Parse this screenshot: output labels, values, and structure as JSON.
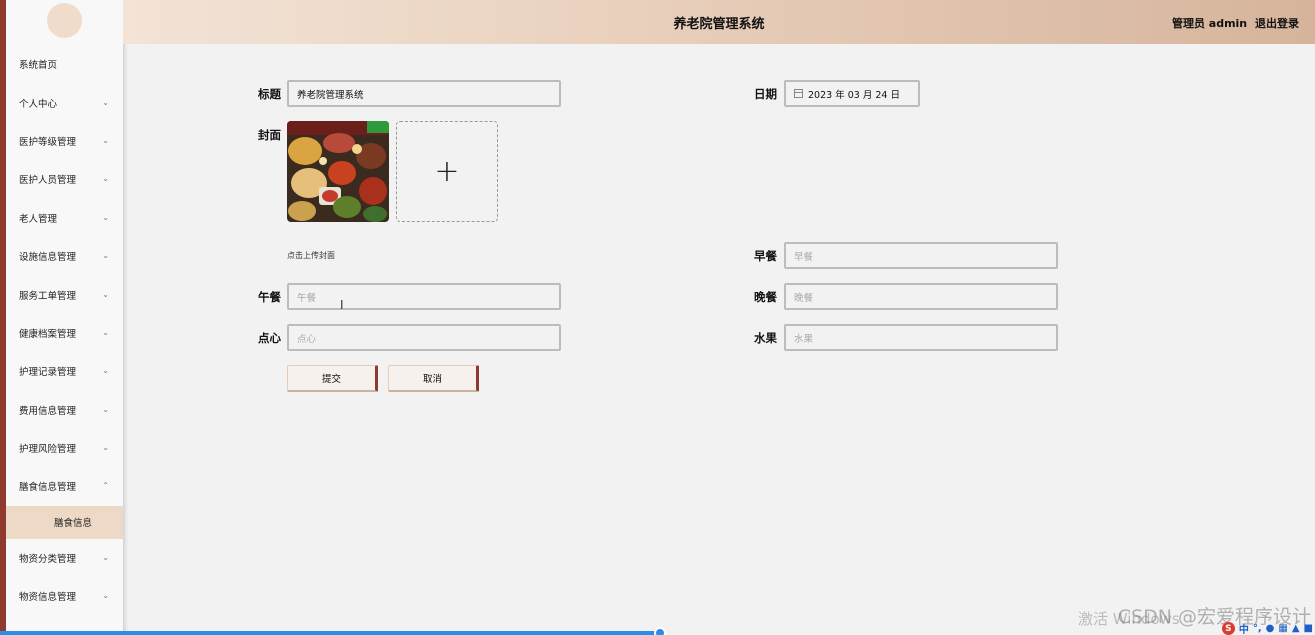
{
  "header": {
    "title": "养老院管理系统",
    "user_role": "管理员 admin",
    "logout": "退出登录"
  },
  "sidebar": {
    "items": [
      {
        "label": "系统首页",
        "expandable": false
      },
      {
        "label": "个人中心",
        "expandable": true
      },
      {
        "label": "医护等级管理",
        "expandable": true
      },
      {
        "label": "医护人员管理",
        "expandable": true
      },
      {
        "label": "老人管理",
        "expandable": true
      },
      {
        "label": "设施信息管理",
        "expandable": true
      },
      {
        "label": "服务工单管理",
        "expandable": true
      },
      {
        "label": "健康档案管理",
        "expandable": true
      },
      {
        "label": "护理记录管理",
        "expandable": true
      },
      {
        "label": "费用信息管理",
        "expandable": true
      },
      {
        "label": "护理风险管理",
        "expandable": true
      },
      {
        "label": "膳食信息管理",
        "expandable": true,
        "expanded": true
      },
      {
        "label": "物资分类管理",
        "expandable": true
      },
      {
        "label": "物资信息管理",
        "expandable": true
      }
    ],
    "sub_item": "膳食信息"
  },
  "form": {
    "title_label": "标题",
    "title_value": "养老院管理系统",
    "date_label": "日期",
    "date_value": "2023 年 03 月 24 日",
    "cover_label": "封面",
    "upload_hint": "点击上传封面",
    "breakfast_label": "早餐",
    "breakfast_placeholder": "早餐",
    "lunch_label": "午餐",
    "lunch_placeholder": "午餐",
    "dinner_label": "晚餐",
    "dinner_placeholder": "晚餐",
    "snack_label": "点心",
    "snack_placeholder": "点心",
    "fruit_label": "水果",
    "fruit_placeholder": "水果",
    "submit": "提交",
    "cancel": "取消"
  },
  "overlay": {
    "watermark": "CSDN @宏爱程序设计",
    "activate": "激活 Windows",
    "ime_lang": "中"
  },
  "colors": {
    "accent": "#8e3a2f",
    "header_start": "#f3e4d7",
    "header_end": "#d6b49b",
    "submenu_bg": "#edd9c5"
  }
}
